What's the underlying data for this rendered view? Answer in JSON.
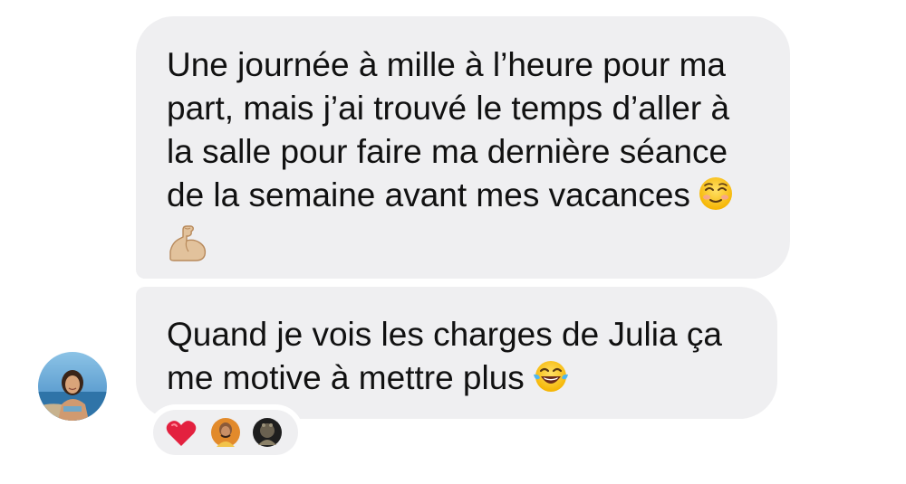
{
  "messages": [
    {
      "lines": [
        "Une journée à mille à l’heure pour ma",
        "part, mais j’ai trouvé le temps d’aller à",
        "la salle pour faire ma dernière séance",
        "de la semaine avant mes vacances"
      ],
      "emojis": [
        "smiling-face-icon",
        "flexed-biceps-icon"
      ]
    },
    {
      "lines": [
        "Quand je vois les charges de Julia ça",
        "me motive à mettre plus"
      ],
      "emojis": [
        "face-with-tears-of-joy-icon"
      ]
    }
  ],
  "sender": {
    "avatar": "avatar-photo"
  },
  "reactions": {
    "items": [
      "red-heart-icon",
      "reactor-avatar-1",
      "reactor-avatar-2"
    ]
  },
  "colors": {
    "bubble": "#efeff1",
    "text": "#111111",
    "heart": "#e3213f"
  }
}
